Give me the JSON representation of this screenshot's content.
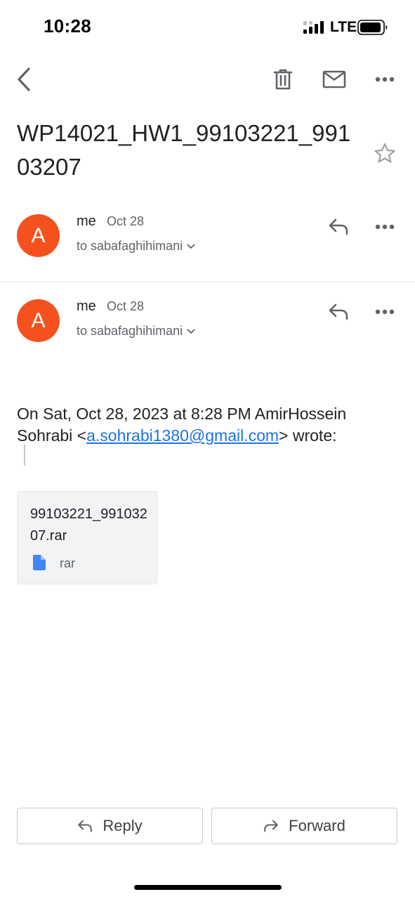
{
  "status_bar": {
    "time": "10:28",
    "network": "LTE"
  },
  "toolbar": {
    "back_icon": "chevron-left-icon",
    "delete_icon": "trash-icon",
    "mark_unread_icon": "mail-icon",
    "more_icon": "more-horizontal-icon"
  },
  "subject": "WP14021_HW1_99103221_99103207",
  "messages": [
    {
      "avatar_letter": "A",
      "sender": "me",
      "date": "Oct 28",
      "recipient": "to sabafaghihimani"
    },
    {
      "avatar_letter": "A",
      "sender": "me",
      "date": "Oct 28",
      "recipient": "to sabafaghihimani"
    }
  ],
  "body": {
    "quote_prefix": "On Sat, Oct 28, 2023 at 8:28 PM AmirHossein Sohrabi <",
    "quote_email": "a.sohrabi1380@gmail.com",
    "quote_suffix": "> wrote:"
  },
  "attachment": {
    "filename": "99103221_99103207.rar",
    "type": "rar"
  },
  "actions": {
    "reply_label": "Reply",
    "forward_label": "Forward"
  },
  "colors": {
    "avatar": "#f4511e",
    "link": "#1a73e8",
    "file_icon": "#4285f4"
  }
}
